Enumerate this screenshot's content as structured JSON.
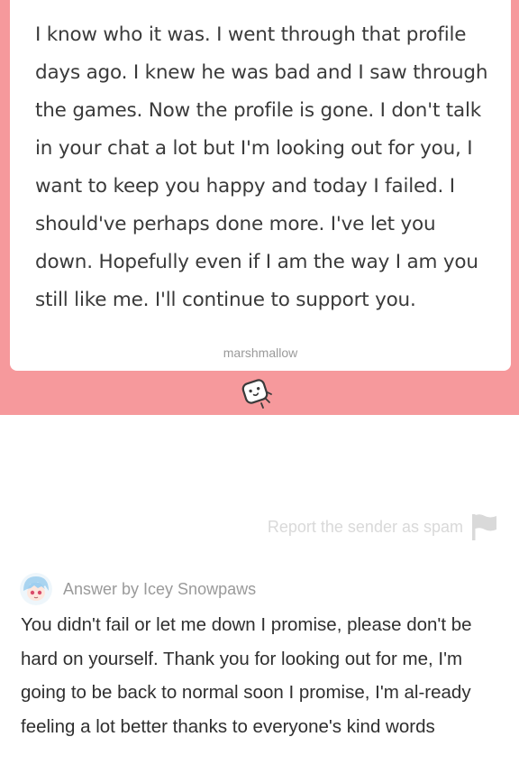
{
  "question": {
    "text": "I know who it was. I went through that profile days ago. I knew he was bad and I saw through the games. Now the profile is gone. I don't talk in your chat a lot but I'm looking out for you, I want to keep you happy and today I failed. I should've perhaps done more. I've let you down. Hopefully even if I am the way I am you still like me. I'll continue to support you.",
    "brand": "marshmallow",
    "logo_icon": "marshmallow-logo-icon"
  },
  "report": {
    "label": "Report the sender as spam",
    "icon": "flag-icon"
  },
  "answer": {
    "by_label": "Answer by Icey Snowpaws",
    "text": "You didn't fail or let me down I promise, please don't be hard on yourself. Thank you for looking out for me, I'm going to be back to normal soon I promise, I'm al-ready feeling a lot better thanks to everyone's kind words",
    "avatar_icon": "avatar"
  },
  "colors": {
    "accent_pink": "#f6999c",
    "card_bg": "#ffffff",
    "muted_text": "#9a9a9a",
    "report_text": "#d9d9d9",
    "body_text": "#2f2f2f"
  }
}
